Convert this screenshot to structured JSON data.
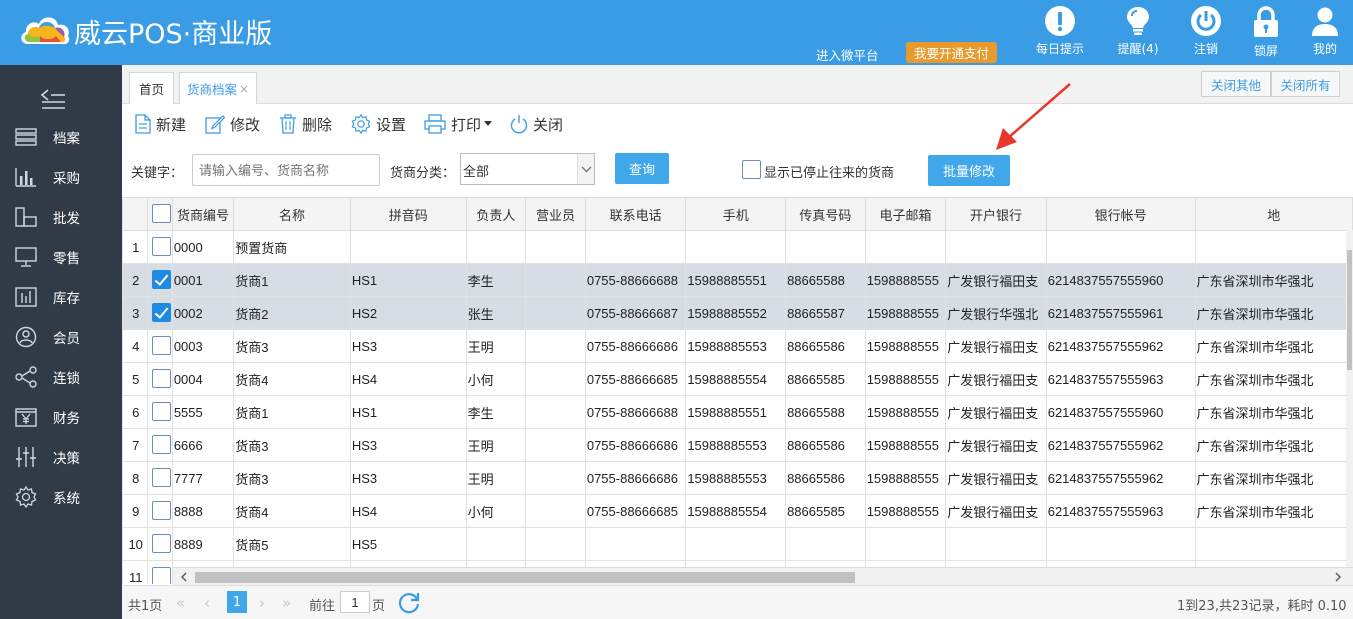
{
  "app": {
    "title": "威云POS·商业版"
  },
  "header": {
    "wx_link": "进入微平台",
    "pay_button": "我要开通支付",
    "icons": [
      {
        "name": "daily-tips",
        "label": "每日提示",
        "icon": "exclamation-icon"
      },
      {
        "name": "reminder",
        "label": "提醒(4)",
        "icon": "bulb-icon"
      },
      {
        "name": "logout",
        "label": "注销",
        "icon": "power-icon"
      },
      {
        "name": "lock-screen",
        "label": "锁屏",
        "icon": "lock-icon"
      },
      {
        "name": "my-account",
        "label": "我的",
        "icon": "user-icon"
      }
    ]
  },
  "sidebar": {
    "items": [
      {
        "label": "档案",
        "icon": "list-icon"
      },
      {
        "label": "采购",
        "icon": "bar-chart-icon"
      },
      {
        "label": "批发",
        "icon": "blocks-icon"
      },
      {
        "label": "零售",
        "icon": "monitor-icon"
      },
      {
        "label": "库存",
        "icon": "stock-icon"
      },
      {
        "label": "会员",
        "icon": "member-icon"
      },
      {
        "label": "连锁",
        "icon": "share-icon"
      },
      {
        "label": "财务",
        "icon": "yen-icon"
      },
      {
        "label": "决策",
        "icon": "sliders-icon"
      },
      {
        "label": "系统",
        "icon": "gear-icon"
      }
    ]
  },
  "tabs": {
    "home": "首页",
    "current": "货商档案",
    "close_glyph": "×",
    "close_others": "关闭其他",
    "close_all": "关闭所有"
  },
  "toolbar": {
    "new": "新建",
    "edit": "修改",
    "delete": "删除",
    "settings": "设置",
    "print": "打印",
    "close": "关闭"
  },
  "filter": {
    "keyword_label": "关键字：",
    "keyword_placeholder": "请输入编号、货商名称",
    "category_label": "货商分类：",
    "category_value": "全部",
    "query_button": "查询",
    "show_stopped_label": "显示已停止往来的货商",
    "batch_edit_button": "批量修改"
  },
  "grid": {
    "columns": [
      "货商编号",
      "名称",
      "拼音码",
      "负责人",
      "营业员",
      "联系电话",
      "手机",
      "传真号码",
      "电子邮箱",
      "开户银行",
      "银行帐号",
      "地"
    ],
    "rows": [
      {
        "n": "1",
        "checked": false,
        "cells": [
          "0000",
          "预置货商",
          "",
          "",
          "",
          "",
          "",
          "",
          "",
          "",
          "",
          ""
        ]
      },
      {
        "n": "2",
        "checked": true,
        "cells": [
          "0001",
          "货商1",
          "HS1",
          "李生",
          "",
          "0755-88666688",
          "15988885551",
          "88665588",
          "1598888555",
          "广发银行福田支",
          "6214837557555960",
          "广东省深圳市华强北"
        ]
      },
      {
        "n": "3",
        "checked": true,
        "cells": [
          "0002",
          "货商2",
          "HS2",
          "张生",
          "",
          "0755-88666687",
          "15988885552",
          "88665587",
          "1598888555",
          "广发银行华强北",
          "6214837557555961",
          "广东省深圳市华强北"
        ]
      },
      {
        "n": "4",
        "checked": false,
        "cells": [
          "0003",
          "货商3",
          "HS3",
          "王明",
          "",
          "0755-88666686",
          "15988885553",
          "88665586",
          "1598888555",
          "广发银行福田支",
          "6214837557555962",
          "广东省深圳市华强北"
        ]
      },
      {
        "n": "5",
        "checked": false,
        "cells": [
          "0004",
          "货商4",
          "HS4",
          "小何",
          "",
          "0755-88666685",
          "15988885554",
          "88665585",
          "1598888555",
          "广发银行福田支",
          "6214837557555963",
          "广东省深圳市华强北"
        ]
      },
      {
        "n": "6",
        "checked": false,
        "cells": [
          "5555",
          "货商1",
          "HS1",
          "李生",
          "",
          "0755-88666688",
          "15988885551",
          "88665588",
          "1598888555",
          "广发银行福田支",
          "6214837557555960",
          "广东省深圳市华强北"
        ]
      },
      {
        "n": "7",
        "checked": false,
        "cells": [
          "6666",
          "货商3",
          "HS3",
          "王明",
          "",
          "0755-88666686",
          "15988885553",
          "88665586",
          "1598888555",
          "广发银行福田支",
          "6214837557555962",
          "广东省深圳市华强北"
        ]
      },
      {
        "n": "8",
        "checked": false,
        "cells": [
          "7777",
          "货商3",
          "HS3",
          "王明",
          "",
          "0755-88666686",
          "15988885553",
          "88665586",
          "1598888555",
          "广发银行福田支",
          "6214837557555962",
          "广东省深圳市华强北"
        ]
      },
      {
        "n": "9",
        "checked": false,
        "cells": [
          "8888",
          "货商4",
          "HS4",
          "小何",
          "",
          "0755-88666685",
          "15988885554",
          "88665585",
          "1598888555",
          "广发银行福田支",
          "6214837557555963",
          "广东省深圳市华强北"
        ]
      },
      {
        "n": "10",
        "checked": false,
        "cells": [
          "8889",
          "货商5",
          "HS5",
          "",
          "",
          "",
          "",
          "",
          "",
          "",
          "",
          ""
        ]
      },
      {
        "n": "11",
        "checked": false,
        "cells": [
          "",
          "",
          "",
          "",
          "",
          "",
          "",
          "",
          "",
          "",
          "",
          ""
        ]
      }
    ]
  },
  "pager": {
    "total_pages": "共1页",
    "current_page": "1",
    "goto_label": "前往",
    "goto_value": "1",
    "page_unit": "页",
    "summary": "1到23,共23记录，耗时 0.10"
  },
  "colors": {
    "header_bg": "#3b9ce6",
    "sidebar_bg": "#313b47",
    "accent": "#3fa7ea",
    "pay_button": "#e89a2c",
    "selected_row": "#d6dde5",
    "annotation_arrow": "#e8382d"
  }
}
